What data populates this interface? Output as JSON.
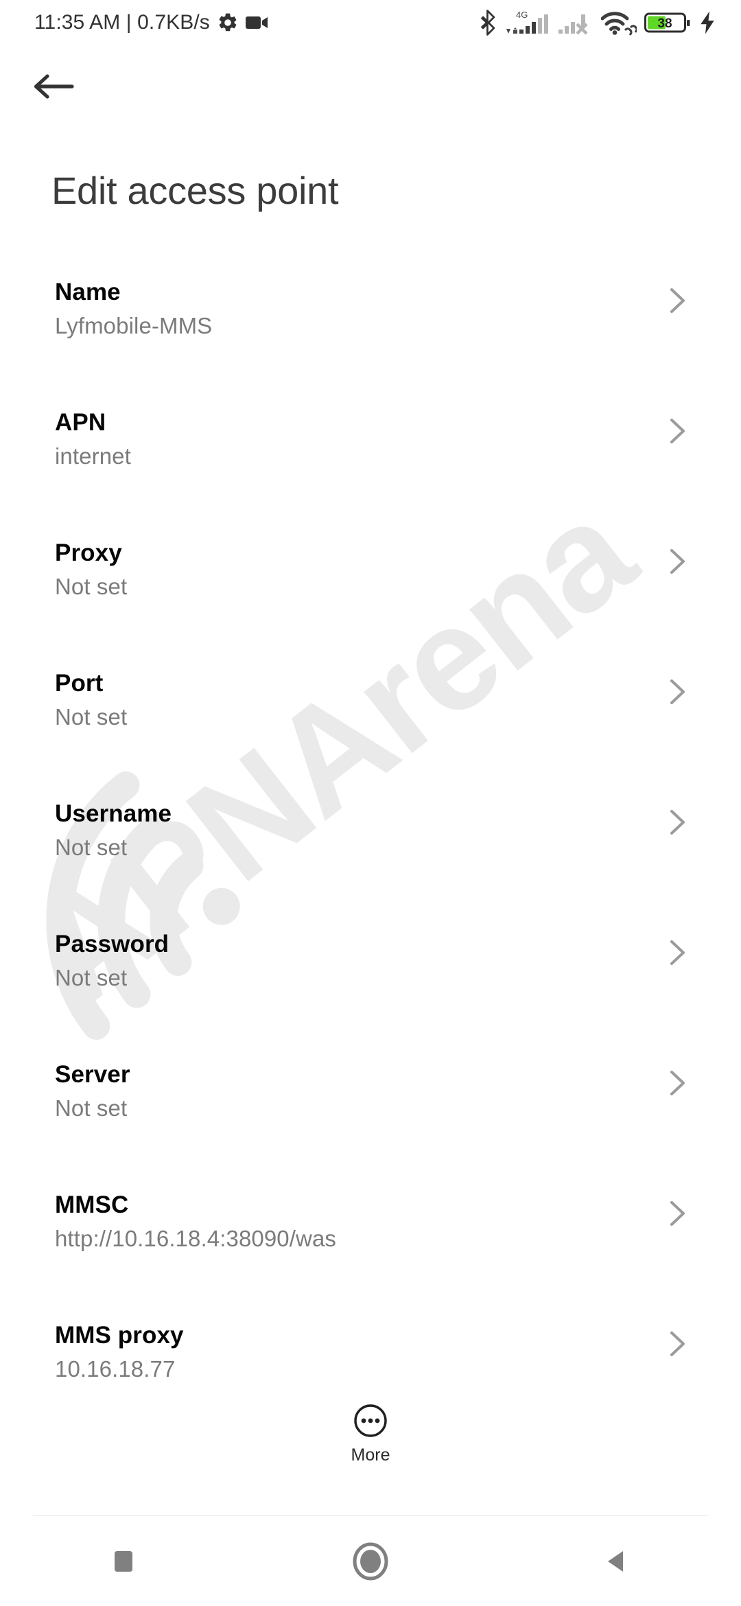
{
  "statusbar": {
    "clock": "11:35 AM",
    "separator": "|",
    "netspeed": "0.7KB/s",
    "gear_icon": "gear-icon",
    "camera_icon": "video-camera-icon",
    "bluetooth_icon": "bluetooth-icon",
    "network_type": "4G",
    "sim1_icon": "signal-bars-sim1-icon",
    "sim2_icon": "signal-bars-sim2-no-service-icon",
    "wifi_icon": "wifi-with-link-icon",
    "battery_level": "38",
    "battery_icon": "battery-icon",
    "charging_icon": "charging-bolt-icon",
    "battery_color": "#5ed726"
  },
  "header": {
    "back_icon": "back-arrow-icon",
    "title": "Edit access point"
  },
  "list": {
    "chevron_icon": "chevron-right-icon",
    "items": [
      {
        "title": "Name",
        "value": "Lyfmobile-MMS"
      },
      {
        "title": "APN",
        "value": "internet"
      },
      {
        "title": "Proxy",
        "value": "Not set"
      },
      {
        "title": "Port",
        "value": "Not set"
      },
      {
        "title": "Username",
        "value": "Not set"
      },
      {
        "title": "Password",
        "value": "Not set"
      },
      {
        "title": "Server",
        "value": "Not set"
      },
      {
        "title": "MMSC",
        "value": "http://10.16.18.4:38090/was"
      },
      {
        "title": "MMS proxy",
        "value": "10.16.18.77"
      }
    ]
  },
  "more": {
    "label": "More",
    "icon": "more-circle-ellipsis-icon"
  },
  "watermark": {
    "text": "APNArena",
    "logo": "wifi-arcs-logo",
    "color": "#eaeaea"
  },
  "navbar": {
    "recents_icon": "recents-square-icon",
    "home_icon": "home-circle-icon",
    "back_icon": "back-triangle-icon",
    "color": "#808080"
  }
}
